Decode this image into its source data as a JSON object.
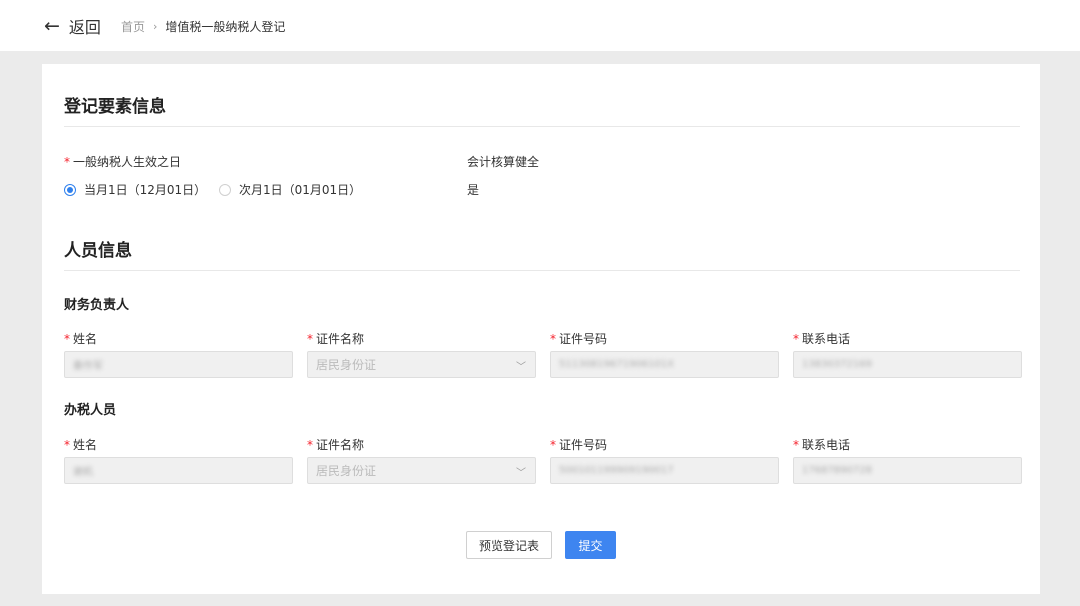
{
  "header": {
    "back_icon": "arrow-left-icon",
    "back_label": "返回",
    "breadcrumb": {
      "home": "首页",
      "separator": "›",
      "current": "增值税一般纳税人登记"
    }
  },
  "registration": {
    "title": "登记要素信息",
    "effective_date": {
      "label": "一般纳税人生效之日",
      "required_mark": "*",
      "options": [
        {
          "label": "当月1日（12月01日）",
          "checked": true
        },
        {
          "label": "次月1日（01月01日）",
          "checked": false
        }
      ]
    },
    "accounting": {
      "label": "会计核算健全",
      "value": "是"
    }
  },
  "personnel": {
    "title": "人员信息",
    "finance_head": {
      "title": "财务负责人",
      "labels": {
        "name": "姓名",
        "id_type": "证件名称",
        "id_number": "证件号码",
        "phone": "联系电话"
      },
      "values": {
        "name": "秦作军",
        "id_type": "居民身份证",
        "id_number": "51130819671906101X",
        "phone": "13830372169"
      }
    },
    "tax_agent": {
      "title": "办税人员",
      "labels": {
        "name": "姓名",
        "id_type": "证件名称",
        "id_number": "证件号码",
        "phone": "联系电话"
      },
      "values": {
        "name": "谢机",
        "id_type": "居民身份证",
        "id_number": "500101199909190017",
        "phone": "17687890728"
      }
    }
  },
  "required_mark": "*",
  "select_icon": "chevron-down-icon",
  "actions": {
    "preview": "预览登记表",
    "submit": "提交"
  },
  "colors": {
    "primary": "#3e85f0",
    "required": "#f5222d",
    "page_bg": "#ebebeb"
  }
}
